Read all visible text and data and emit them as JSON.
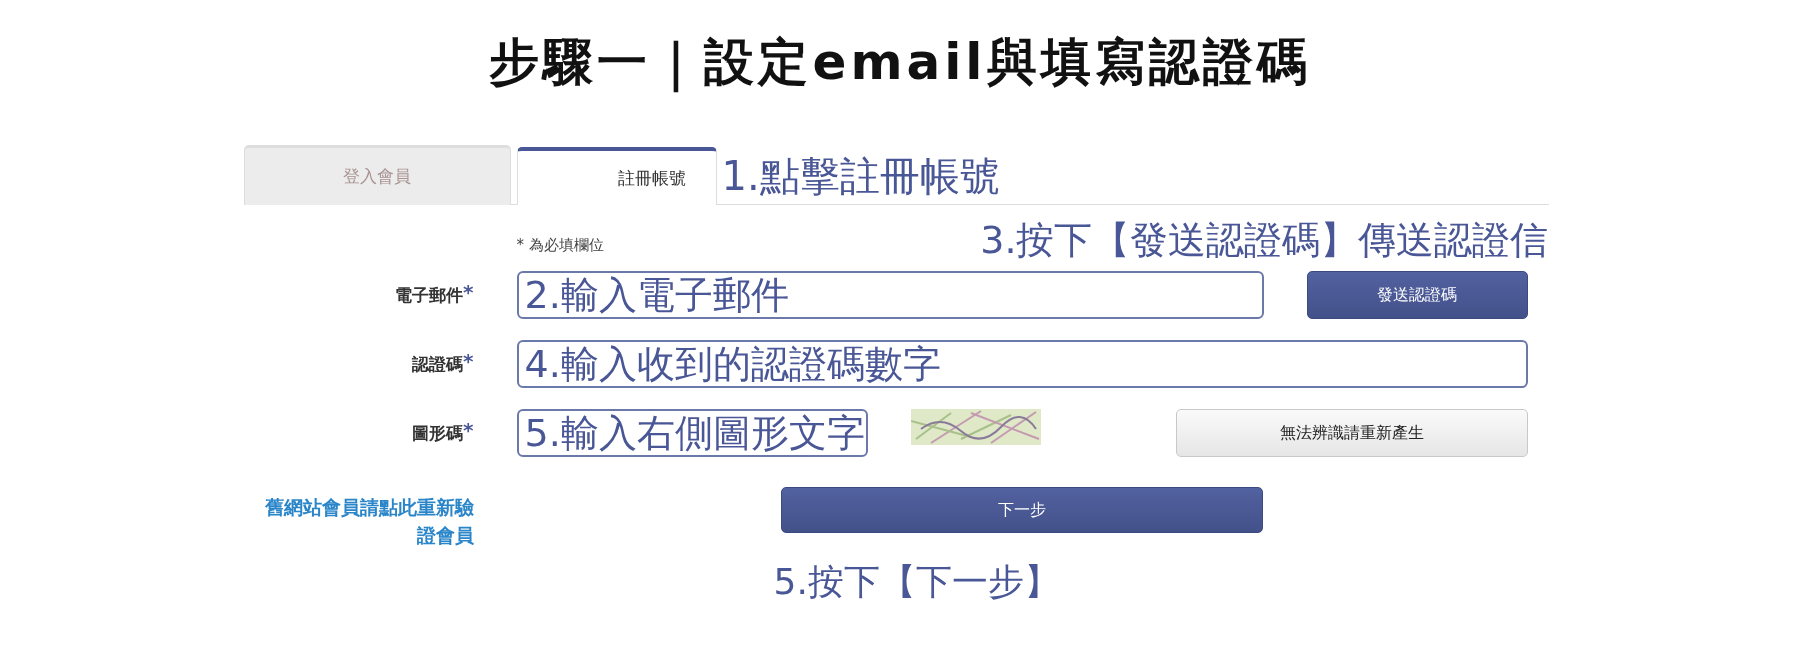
{
  "title": "步驟一｜設定email與填寫認證碼",
  "tabs": [
    {
      "label": "登入會員",
      "selected": false
    },
    {
      "label": "註冊帳號",
      "selected": true
    }
  ],
  "tab_note": "1.點擊註冊帳號",
  "required_note": "* 為必填欄位",
  "send_note": "3.按下【發送認證碼】傳送認證信",
  "fields": [
    {
      "kind": "email",
      "label": "電子郵件",
      "mark": "*",
      "annotation": "2.輸入電子郵件",
      "button": "發送認證碼"
    },
    {
      "kind": "code",
      "label": "認證碼",
      "mark": "*",
      "annotation": "4.輸入收到的認證碼數字"
    },
    {
      "kind": "captcha",
      "label": "圖形碼",
      "mark": "*",
      "annotation": "5.輸入右側圖形文字",
      "button": "無法辨識請重新產生"
    }
  ],
  "legacy_link": "舊網站會員請點此重新驗證會員",
  "next_button": "下一步",
  "next_note": "5.按下【下一步】"
}
